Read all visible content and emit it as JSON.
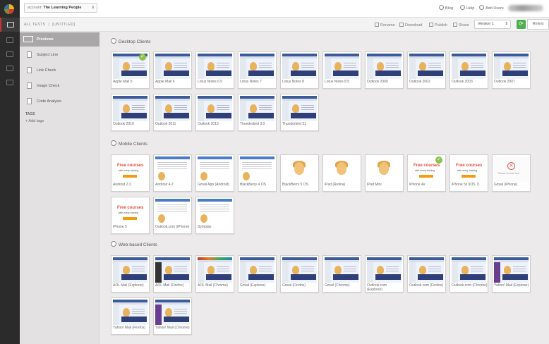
{
  "header": {
    "account_prefix": "account:",
    "account_name": "The Learning People",
    "links": {
      "blog": "Blog",
      "help": "Help",
      "add_users": "Add Users"
    }
  },
  "breadcrumb": {
    "root": "ALL TESTS",
    "separator": "/",
    "current": "[UNTITLED]"
  },
  "toolbar": {
    "rename": "Rename",
    "download": "Download",
    "publish": "Publish",
    "share": "Share",
    "version": "Version 1",
    "retest": "Retest"
  },
  "sidebar": {
    "items": [
      {
        "label": "Previews"
      },
      {
        "label": "Subject Line"
      },
      {
        "label": "Link Check"
      },
      {
        "label": "Image Check"
      },
      {
        "label": "Code Analysis"
      }
    ],
    "tags_heading": "TAGS",
    "add_tags": "+ Add tags"
  },
  "sections": {
    "desktop": {
      "title": "Desktop Clients",
      "clients": [
        "Apple Mail 5",
        "Apple Mail 6",
        "Lotus Notes 6.5",
        "Lotus Notes 7",
        "Lotus Notes 8",
        "Lotus Notes 8.5",
        "Outlook 2000",
        "Outlook 2002",
        "Outlook 2003",
        "Outlook 2007",
        "Outlook 2010",
        "Outlook 2011",
        "Outlook 2013",
        "Thunderbird 3.0",
        "Thunderbird 31"
      ]
    },
    "mobile": {
      "title": "Mobile Clients",
      "clients": [
        "Android 2.3",
        "Android 4.2",
        "Gmail App (Android)",
        "BlackBerry 4 OS",
        "BlackBerry 5 OS",
        "iPad (Retina)",
        "iPad Mini",
        "iPhone 4s",
        "iPhone 5s (iOS 7)",
        "Gmail (iPhone)",
        "iPhone 5",
        "Outlook.com (iPhone)",
        "Symbian"
      ]
    },
    "web": {
      "title": "Web-based Clients",
      "clients": [
        "AOL Mail (Explorer)",
        "AOL Mail (Firefox)",
        "AOL Mail (Chrome)",
        "Gmail (Explorer)",
        "Gmail (Firefox)",
        "Gmail (Chrome)",
        "Outlook.com (Explorer)",
        "Outlook.com (Firefox)",
        "Outlook.com (Chrome)",
        "Yahoo! Mail (Explorer)",
        "Yahoo! Mail (Firefox)",
        "Yahoo! Mail (Chrome)"
      ]
    }
  },
  "mobile_preview": {
    "headline": "Free courses",
    "subline": "with every training",
    "error": "Please recover test"
  }
}
